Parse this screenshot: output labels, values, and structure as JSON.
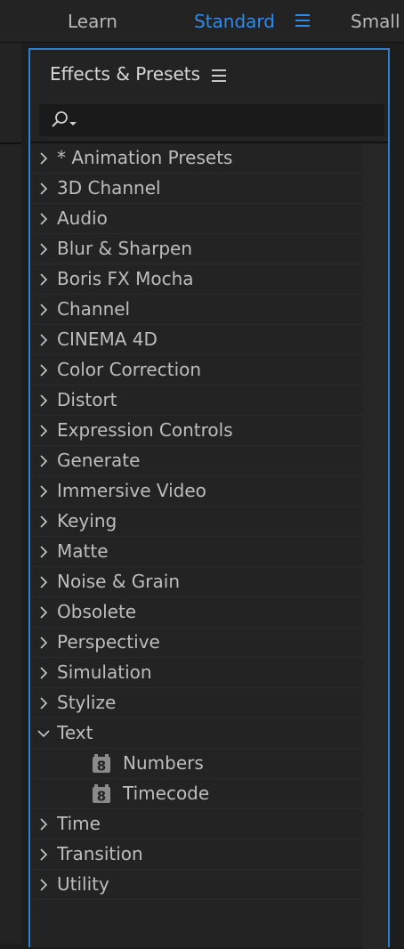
{
  "workspace": {
    "tabs": [
      {
        "label": "Learn"
      },
      {
        "label": "Standard"
      },
      {
        "label": "Small"
      }
    ],
    "active_tab": "Standard",
    "accent_color": "#2d8ceb"
  },
  "panel": {
    "title": "Effects & Presets",
    "border_color": "#2d7fcf",
    "search": {
      "value": "",
      "placeholder": ""
    },
    "items": [
      {
        "label": "* Animation Presets",
        "expanded": false
      },
      {
        "label": "3D Channel",
        "expanded": false
      },
      {
        "label": "Audio",
        "expanded": false
      },
      {
        "label": "Blur & Sharpen",
        "expanded": false
      },
      {
        "label": "Boris FX Mocha",
        "expanded": false
      },
      {
        "label": "Channel",
        "expanded": false
      },
      {
        "label": "CINEMA 4D",
        "expanded": false
      },
      {
        "label": "Color Correction",
        "expanded": false
      },
      {
        "label": "Distort",
        "expanded": false
      },
      {
        "label": "Expression Controls",
        "expanded": false
      },
      {
        "label": "Generate",
        "expanded": false
      },
      {
        "label": "Immersive Video",
        "expanded": false
      },
      {
        "label": "Keying",
        "expanded": false
      },
      {
        "label": "Matte",
        "expanded": false
      },
      {
        "label": "Noise & Grain",
        "expanded": false
      },
      {
        "label": "Obsolete",
        "expanded": false
      },
      {
        "label": "Perspective",
        "expanded": false
      },
      {
        "label": "Simulation",
        "expanded": false
      },
      {
        "label": "Stylize",
        "expanded": false
      },
      {
        "label": "Text",
        "expanded": true,
        "children": [
          {
            "label": "Numbers",
            "icon": "effect-8bit-icon"
          },
          {
            "label": "Timecode",
            "icon": "effect-8bit-icon"
          }
        ]
      },
      {
        "label": "Time",
        "expanded": false
      },
      {
        "label": "Transition",
        "expanded": false
      },
      {
        "label": "Utility",
        "expanded": false
      }
    ]
  }
}
